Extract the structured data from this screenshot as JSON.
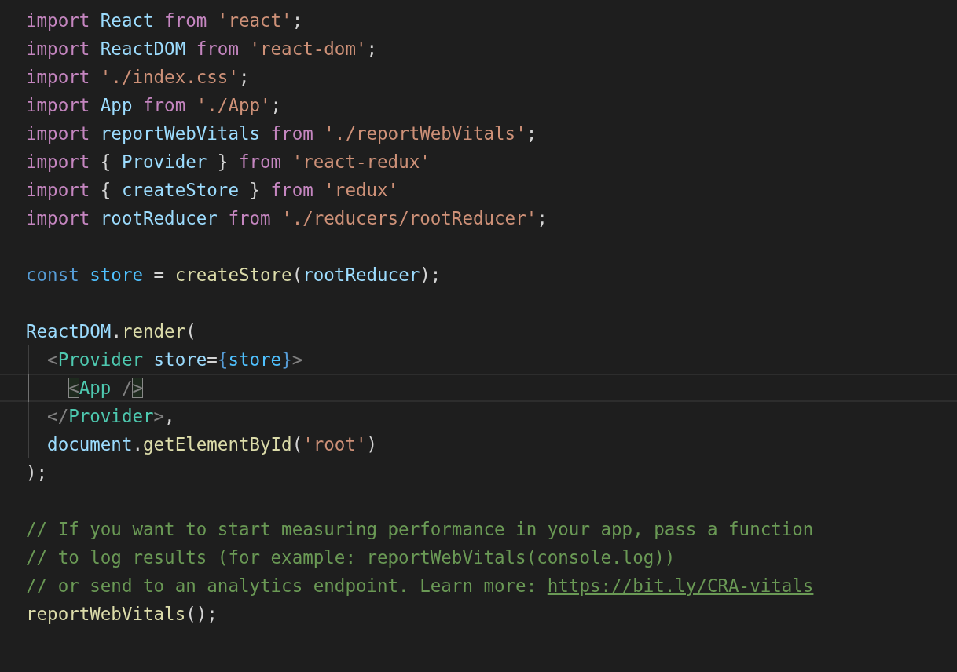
{
  "editor": {
    "lines": [
      {
        "kind": "code",
        "current": false,
        "tokens": [
          {
            "kind": "keyword",
            "text": "import "
          },
          {
            "kind": "variable",
            "text": "React "
          },
          {
            "kind": "keyword",
            "text": "from "
          },
          {
            "kind": "string",
            "text": "'react'"
          },
          {
            "kind": "plain",
            "text": ";"
          }
        ]
      },
      {
        "kind": "code",
        "current": false,
        "tokens": [
          {
            "kind": "keyword",
            "text": "import "
          },
          {
            "kind": "variable",
            "text": "ReactDOM "
          },
          {
            "kind": "keyword",
            "text": "from "
          },
          {
            "kind": "string",
            "text": "'react-dom'"
          },
          {
            "kind": "plain",
            "text": ";"
          }
        ]
      },
      {
        "kind": "code",
        "current": false,
        "tokens": [
          {
            "kind": "keyword",
            "text": "import "
          },
          {
            "kind": "string",
            "text": "'./index.css'"
          },
          {
            "kind": "plain",
            "text": ";"
          }
        ]
      },
      {
        "kind": "code",
        "current": false,
        "tokens": [
          {
            "kind": "keyword",
            "text": "import "
          },
          {
            "kind": "variable",
            "text": "App "
          },
          {
            "kind": "keyword",
            "text": "from "
          },
          {
            "kind": "string",
            "text": "'./App'"
          },
          {
            "kind": "plain",
            "text": ";"
          }
        ]
      },
      {
        "kind": "code",
        "current": false,
        "tokens": [
          {
            "kind": "keyword",
            "text": "import "
          },
          {
            "kind": "variable",
            "text": "reportWebVitals "
          },
          {
            "kind": "keyword",
            "text": "from "
          },
          {
            "kind": "string",
            "text": "'./reportWebVitals'"
          },
          {
            "kind": "plain",
            "text": ";"
          }
        ]
      },
      {
        "kind": "code",
        "current": false,
        "tokens": [
          {
            "kind": "keyword",
            "text": "import "
          },
          {
            "kind": "plain",
            "text": "{ "
          },
          {
            "kind": "variable",
            "text": "Provider "
          },
          {
            "kind": "plain",
            "text": "} "
          },
          {
            "kind": "keyword",
            "text": "from "
          },
          {
            "kind": "string",
            "text": "'react-redux'"
          }
        ]
      },
      {
        "kind": "code",
        "current": false,
        "tokens": [
          {
            "kind": "keyword",
            "text": "import "
          },
          {
            "kind": "plain",
            "text": "{ "
          },
          {
            "kind": "variable",
            "text": "createStore "
          },
          {
            "kind": "plain",
            "text": "} "
          },
          {
            "kind": "keyword",
            "text": "from "
          },
          {
            "kind": "string",
            "text": "'redux'"
          }
        ]
      },
      {
        "kind": "code",
        "current": false,
        "tokens": [
          {
            "kind": "keyword",
            "text": "import "
          },
          {
            "kind": "variable",
            "text": "rootReducer "
          },
          {
            "kind": "keyword",
            "text": "from "
          },
          {
            "kind": "string",
            "text": "'./reducers/rootReducer'"
          },
          {
            "kind": "plain",
            "text": ";"
          }
        ]
      },
      {
        "kind": "blank"
      },
      {
        "kind": "code",
        "current": false,
        "tokens": [
          {
            "kind": "storage",
            "text": "const "
          },
          {
            "kind": "constant",
            "text": "store "
          },
          {
            "kind": "plain",
            "text": "= "
          },
          {
            "kind": "function",
            "text": "createStore"
          },
          {
            "kind": "plain",
            "text": "("
          },
          {
            "kind": "variable",
            "text": "rootReducer"
          },
          {
            "kind": "plain",
            "text": ");"
          }
        ]
      },
      {
        "kind": "blank"
      },
      {
        "kind": "code",
        "current": false,
        "tokens": [
          {
            "kind": "variable",
            "text": "ReactDOM"
          },
          {
            "kind": "plain",
            "text": "."
          },
          {
            "kind": "function",
            "text": "render"
          },
          {
            "kind": "plain",
            "text": "("
          }
        ]
      },
      {
        "kind": "code",
        "current": false,
        "tokens": [
          {
            "kind": "punct",
            "text": "  <"
          },
          {
            "kind": "tag",
            "text": "Provider "
          },
          {
            "kind": "variable",
            "text": "store"
          },
          {
            "kind": "plain",
            "text": "="
          },
          {
            "kind": "brace",
            "text": "{"
          },
          {
            "kind": "constant",
            "text": "store"
          },
          {
            "kind": "brace",
            "text": "}"
          },
          {
            "kind": "punct",
            "text": ">"
          }
        ]
      },
      {
        "kind": "code",
        "current": true,
        "tokens": [
          {
            "kind": "punct",
            "text": "    <",
            "matched": true
          },
          {
            "kind": "tag",
            "text": "App "
          },
          {
            "kind": "punct",
            "text": "/"
          },
          {
            "kind": "punct",
            "text": ">",
            "matched": true
          }
        ]
      },
      {
        "kind": "code",
        "current": false,
        "tokens": [
          {
            "kind": "punct",
            "text": "  </"
          },
          {
            "kind": "tag",
            "text": "Provider"
          },
          {
            "kind": "punct",
            "text": ">"
          },
          {
            "kind": "plain",
            "text": ","
          }
        ]
      },
      {
        "kind": "code",
        "current": false,
        "tokens": [
          {
            "kind": "variable",
            "text": "  document"
          },
          {
            "kind": "plain",
            "text": "."
          },
          {
            "kind": "function",
            "text": "getElementById"
          },
          {
            "kind": "plain",
            "text": "("
          },
          {
            "kind": "string",
            "text": "'root'"
          },
          {
            "kind": "plain",
            "text": ")"
          }
        ]
      },
      {
        "kind": "code",
        "current": false,
        "tokens": [
          {
            "kind": "plain",
            "text": ");"
          }
        ]
      },
      {
        "kind": "blank"
      },
      {
        "kind": "code",
        "current": false,
        "tokens": [
          {
            "kind": "comment",
            "text": "// If you want to start measuring performance in your app, pass a function"
          }
        ]
      },
      {
        "kind": "code",
        "current": false,
        "tokens": [
          {
            "kind": "comment",
            "text": "// to log results (for example: reportWebVitals(console.log))"
          }
        ]
      },
      {
        "kind": "code",
        "current": false,
        "tokens": [
          {
            "kind": "comment",
            "text": "// or send to an analytics endpoint. Learn more: "
          },
          {
            "kind": "link",
            "text": "https://bit.ly/CRA-vitals"
          }
        ]
      },
      {
        "kind": "code",
        "current": false,
        "tokens": [
          {
            "kind": "function",
            "text": "reportWebVitals"
          },
          {
            "kind": "plain",
            "text": "();"
          }
        ]
      }
    ]
  }
}
